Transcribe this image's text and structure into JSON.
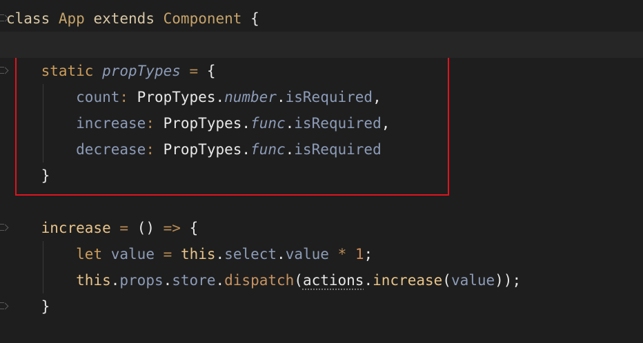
{
  "code_lines": [
    {
      "tokens": [
        {
          "t": "class",
          "c": "kw-class"
        },
        {
          "t": " "
        },
        {
          "t": "App",
          "c": "cls"
        },
        {
          "t": " "
        },
        {
          "t": "extends",
          "c": "kw-class"
        },
        {
          "t": " "
        },
        {
          "t": "Component",
          "c": "cls"
        },
        {
          "t": " {",
          "c": "plain"
        }
      ]
    },
    {
      "tokens": []
    },
    {
      "tokens": [
        {
          "t": "    "
        },
        {
          "t": "static",
          "c": "kw-storage"
        },
        {
          "t": " "
        },
        {
          "t": "propTypes",
          "c": "italic"
        },
        {
          "t": " "
        },
        {
          "t": "=",
          "c": "op"
        },
        {
          "t": " {",
          "c": "plain"
        }
      ]
    },
    {
      "tokens": [
        {
          "t": "        "
        },
        {
          "t": "count",
          "c": "prop"
        },
        {
          "t": ":",
          "c": "op"
        },
        {
          "t": " PropTypes.",
          "c": "typ"
        },
        {
          "t": "number",
          "c": "italic"
        },
        {
          "t": ".",
          "c": "plain"
        },
        {
          "t": "isRequired",
          "c": "prop"
        },
        {
          "t": ",",
          "c": "plain"
        }
      ]
    },
    {
      "tokens": [
        {
          "t": "        "
        },
        {
          "t": "increase",
          "c": "prop"
        },
        {
          "t": ":",
          "c": "op"
        },
        {
          "t": " PropTypes.",
          "c": "typ"
        },
        {
          "t": "func",
          "c": "italic"
        },
        {
          "t": ".",
          "c": "plain"
        },
        {
          "t": "isRequired",
          "c": "prop"
        },
        {
          "t": ",",
          "c": "plain"
        }
      ]
    },
    {
      "tokens": [
        {
          "t": "        "
        },
        {
          "t": "decrease",
          "c": "prop"
        },
        {
          "t": ":",
          "c": "op"
        },
        {
          "t": " PropTypes.",
          "c": "typ"
        },
        {
          "t": "func",
          "c": "italic"
        },
        {
          "t": ".",
          "c": "plain"
        },
        {
          "t": "isRequired",
          "c": "prop"
        }
      ]
    },
    {
      "tokens": [
        {
          "t": "    "
        },
        {
          "t": "}",
          "c": "plain"
        }
      ]
    },
    {
      "tokens": []
    },
    {
      "tokens": [
        {
          "t": "    "
        },
        {
          "t": "increase",
          "c": "fn-name"
        },
        {
          "t": " "
        },
        {
          "t": "=",
          "c": "op"
        },
        {
          "t": " () ",
          "c": "plain"
        },
        {
          "t": "=>",
          "c": "op"
        },
        {
          "t": " {",
          "c": "plain"
        }
      ]
    },
    {
      "tokens": [
        {
          "t": "        "
        },
        {
          "t": "let",
          "c": "kw-storage"
        },
        {
          "t": " "
        },
        {
          "t": "value",
          "c": "prop"
        },
        {
          "t": " "
        },
        {
          "t": "=",
          "c": "op"
        },
        {
          "t": " "
        },
        {
          "t": "this",
          "c": "fn-name"
        },
        {
          "t": ".",
          "c": "plain"
        },
        {
          "t": "select",
          "c": "prop"
        },
        {
          "t": ".",
          "c": "plain"
        },
        {
          "t": "value",
          "c": "prop"
        },
        {
          "t": " "
        },
        {
          "t": "*",
          "c": "op"
        },
        {
          "t": " "
        },
        {
          "t": "1",
          "c": "num"
        },
        {
          "t": ";",
          "c": "plain"
        }
      ]
    },
    {
      "tokens": [
        {
          "t": "        "
        },
        {
          "t": "this",
          "c": "fn-name"
        },
        {
          "t": ".",
          "c": "plain"
        },
        {
          "t": "props",
          "c": "prop"
        },
        {
          "t": ".",
          "c": "plain"
        },
        {
          "t": "store",
          "c": "prop"
        },
        {
          "t": ".",
          "c": "plain"
        },
        {
          "t": "dispatch",
          "c": "method"
        },
        {
          "t": "(",
          "c": "plain"
        },
        {
          "t": "actions",
          "c": "plain",
          "u": true
        },
        {
          "t": ".",
          "c": "plain"
        },
        {
          "t": "increase",
          "c": "fn-name"
        },
        {
          "t": "(",
          "c": "plain"
        },
        {
          "t": "value",
          "c": "prop"
        },
        {
          "t": "));",
          "c": "plain"
        }
      ]
    },
    {
      "tokens": [
        {
          "t": "    "
        },
        {
          "t": "}",
          "c": "plain"
        }
      ]
    }
  ],
  "colors": {
    "background": "#1e1e1e",
    "current_line": "#262626",
    "highlight_border": "#e0141e"
  },
  "icons": {
    "fold_marker": "fold-icon"
  }
}
